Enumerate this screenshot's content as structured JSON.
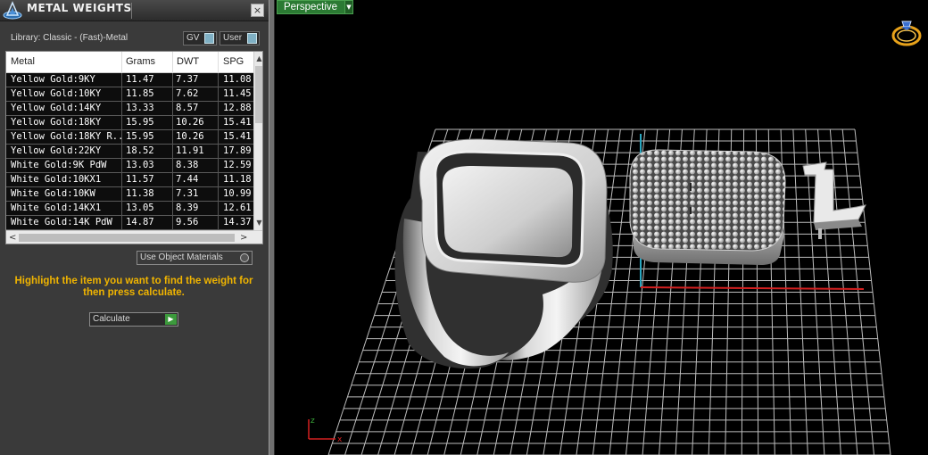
{
  "panel": {
    "title": "METAL WEIGHTS",
    "close_label": "×",
    "library_label": "Library: Classic - (Fast)-Metal",
    "toggle_gv": "GV",
    "toggle_user": "User",
    "use_object_materials": "Use Object Materials",
    "hint": "Highlight the item you want to find the weight for then press calculate.",
    "calculate_label": "Calculate"
  },
  "table": {
    "headers": {
      "metal": "Metal",
      "grams": "Grams",
      "dwt": "DWT",
      "spg": "SPG"
    },
    "rows": [
      {
        "metal": "Yellow Gold:9KY",
        "grams": "11.47",
        "dwt": "7.37",
        "spg": "11.08"
      },
      {
        "metal": "Yellow Gold:10KY",
        "grams": "11.85",
        "dwt": "7.62",
        "spg": "11.45"
      },
      {
        "metal": "Yellow Gold:14KY",
        "grams": "13.33",
        "dwt": "8.57",
        "spg": "12.88"
      },
      {
        "metal": "Yellow Gold:18KY",
        "grams": "15.95",
        "dwt": "10.26",
        "spg": "15.41"
      },
      {
        "metal": "Yellow Gold:18KY R...",
        "grams": "15.95",
        "dwt": "10.26",
        "spg": "15.41"
      },
      {
        "metal": "Yellow Gold:22KY",
        "grams": "18.52",
        "dwt": "11.91",
        "spg": "17.89"
      },
      {
        "metal": "White Gold:9K PdW",
        "grams": "13.03",
        "dwt": "8.38",
        "spg": "12.59"
      },
      {
        "metal": "White Gold:10KX1",
        "grams": "11.57",
        "dwt": "7.44",
        "spg": "11.18"
      },
      {
        "metal": "White Gold:10KW",
        "grams": "11.38",
        "dwt": "7.31",
        "spg": "10.99"
      },
      {
        "metal": "White Gold:14KX1",
        "grams": "13.05",
        "dwt": "8.39",
        "spg": "12.61"
      },
      {
        "metal": "White Gold:14K PdW",
        "grams": "14.87",
        "dwt": "9.56",
        "spg": "14.37"
      }
    ]
  },
  "viewport": {
    "view_mode": "Perspective",
    "letter": "L",
    "axis_z": "z",
    "axis_x": "x"
  },
  "colors": {
    "accent_green": "#2b7a33",
    "hint_yellow": "#f0b400",
    "grid_line": "#bdbdbd",
    "axis_red": "#d42020",
    "axis_cyan": "#2aa7c0"
  },
  "icons": [
    "app-logo-icon",
    "close-icon",
    "toggle-knob-icon",
    "radio-icon",
    "play-icon",
    "dropdown-arrow-icon",
    "ring-icon",
    "axes-icon"
  ]
}
